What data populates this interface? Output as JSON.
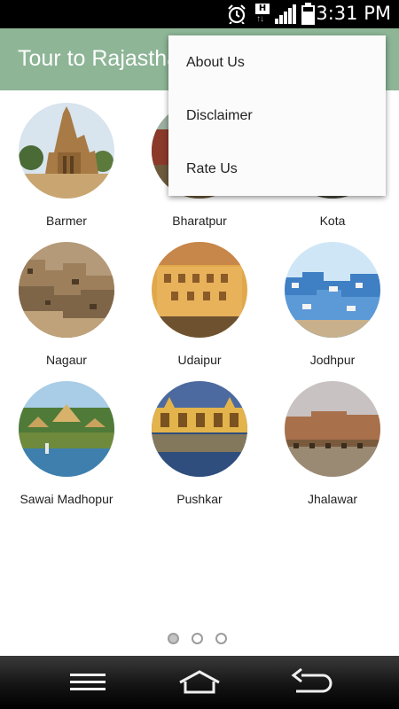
{
  "status_bar": {
    "time": "3:31 PM",
    "network_label": "H",
    "icons": [
      "alarm-clock-icon",
      "hspa-data-icon",
      "signal-icon",
      "battery-icon"
    ],
    "battery_level": 0.7
  },
  "app_bar": {
    "title": "Tour to Rajasthan",
    "color": "#8db596"
  },
  "menu": {
    "items": [
      {
        "label": "About Us"
      },
      {
        "label": "Disclaimer"
      },
      {
        "label": "Rate Us"
      }
    ]
  },
  "cities": [
    {
      "name": "Barmer"
    },
    {
      "name": "Bharatpur"
    },
    {
      "name": "Kota"
    },
    {
      "name": "Nagaur"
    },
    {
      "name": "Udaipur"
    },
    {
      "name": "Jodhpur"
    },
    {
      "name": "Sawai Madhopur"
    },
    {
      "name": "Pushkar"
    },
    {
      "name": "Jhalawar"
    }
  ],
  "pager": {
    "pages": 3,
    "current": 1
  },
  "nav_bar": {
    "buttons": [
      "menu-icon",
      "home-icon",
      "back-icon"
    ]
  }
}
